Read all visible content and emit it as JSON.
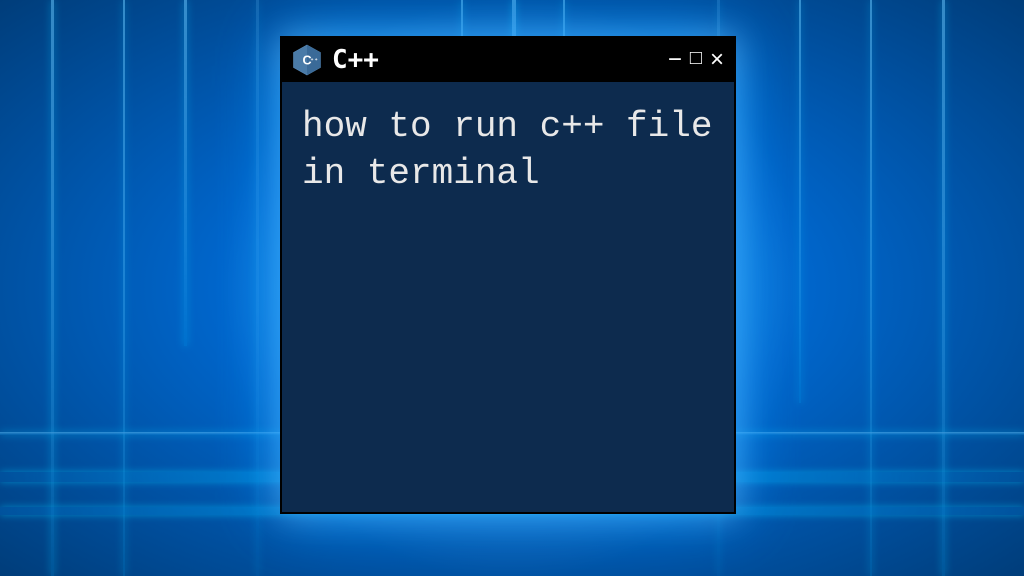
{
  "window": {
    "title": "C++",
    "controls": {
      "minimize": "−",
      "maximize": "□",
      "close": "×"
    }
  },
  "terminal": {
    "content": "how to run c++ file in terminal"
  }
}
